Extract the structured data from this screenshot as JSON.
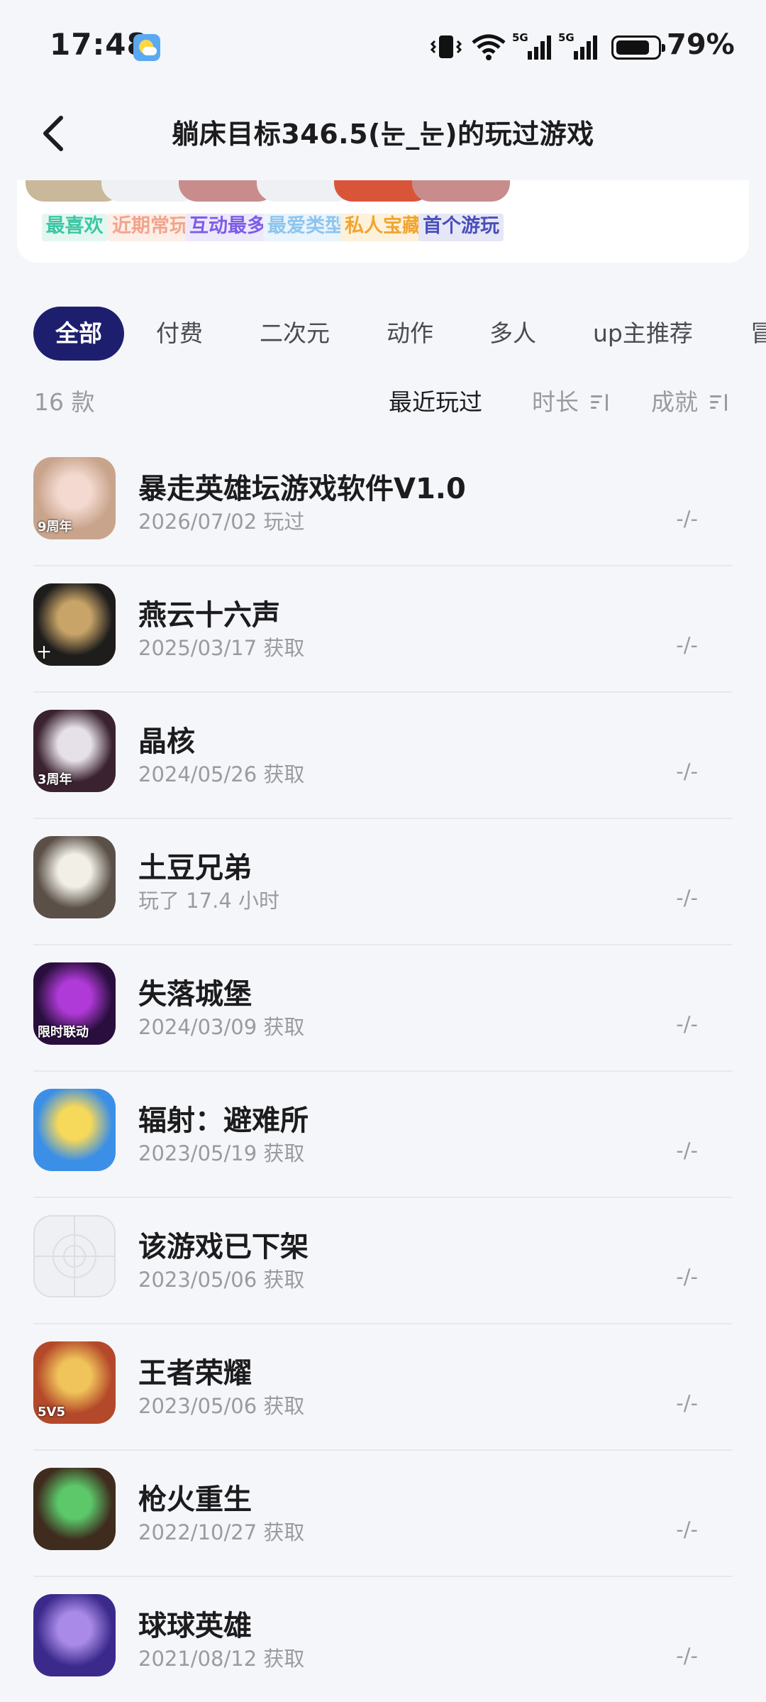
{
  "status_bar": {
    "time": "17:48",
    "battery": "79%",
    "network": "5G",
    "icons": [
      "weather-icon",
      "vibrate-icon",
      "wifi-icon",
      "signal-icon",
      "signal-icon",
      "battery-icon"
    ]
  },
  "nav": {
    "title": "躺床目标346.5(눈_눈)的玩过游戏",
    "back_icon": "chevron-left-icon"
  },
  "highlights": [
    {
      "label": "最喜欢",
      "color": "#3cc7a4",
      "bg": "#e3f7f0",
      "thumb": "#c9b89a"
    },
    {
      "label": "近期常玩",
      "color": "#f2a48c",
      "bg": "#fdeee8",
      "thumb": "#eef0f4"
    },
    {
      "label": "互动最多",
      "color": "#7d5ce8",
      "bg": "#eee8fc",
      "thumb": "#c98c8c"
    },
    {
      "label": "最爱类型",
      "color": "#8ec5ee",
      "bg": "#e9f4fc",
      "thumb": "#eef0f4"
    },
    {
      "label": "私人宝藏",
      "color": "#f1a52f",
      "bg": "#fdf1dc",
      "thumb": "#d9553a"
    },
    {
      "label": "首个游玩",
      "color": "#4a4fb8",
      "bg": "#e5e7f7",
      "thumb": "#c98c8c"
    }
  ],
  "filter_tabs": [
    {
      "label": "全部",
      "active": true
    },
    {
      "label": "付费",
      "active": false
    },
    {
      "label": "二次元",
      "active": false
    },
    {
      "label": "动作",
      "active": false
    },
    {
      "label": "多人",
      "active": false
    },
    {
      "label": "up主推荐",
      "active": false
    },
    {
      "label": "冒",
      "active": false
    }
  ],
  "sort": {
    "count": "16 款",
    "options": [
      {
        "label": "最近玩过",
        "active": true
      },
      {
        "label": "时长",
        "active": false
      },
      {
        "label": "成就",
        "active": false
      }
    ]
  },
  "games": [
    {
      "name": "暴走英雄坛游戏软件V1.0",
      "meta": "2026/07/02 玩过",
      "score": "-/-",
      "icon_color": "#c9a48c",
      "icon_accent": "#f3d9cf",
      "badge": "9周年"
    },
    {
      "name": "燕云十六声",
      "meta": "2025/03/17 获取",
      "score": "-/-",
      "icon_color": "#1e1d1c",
      "icon_accent": "#c8a468",
      "badge": "十"
    },
    {
      "name": "晶核",
      "meta": "2024/05/26 获取",
      "score": "-/-",
      "icon_color": "#3b2230",
      "icon_accent": "#e6e1e8",
      "badge": "3周年"
    },
    {
      "name": "土豆兄弟",
      "meta": "玩了 17.4 小时",
      "score": "-/-",
      "icon_color": "#5a5048",
      "icon_accent": "#f1efe6",
      "badge": ""
    },
    {
      "name": "失落城堡",
      "meta": "2024/03/09 获取",
      "score": "-/-",
      "icon_color": "#2a0f3e",
      "icon_accent": "#b03ad8",
      "badge": "限时联动"
    },
    {
      "name": "辐射：避难所",
      "meta": "2023/05/19 获取",
      "score": "-/-",
      "icon_color": "#3c8fe6",
      "icon_accent": "#f6d85a",
      "badge": ""
    },
    {
      "name": "该游戏已下架",
      "meta": "2023/05/06 获取",
      "score": "-/-",
      "icon_color": "#eef0f3",
      "icon_accent": "#dcdee3",
      "badge": ""
    },
    {
      "name": "王者荣耀",
      "meta": "2023/05/06 获取",
      "score": "-/-",
      "icon_color": "#b4482a",
      "icon_accent": "#f0c45a",
      "badge": "5V5"
    },
    {
      "name": "枪火重生",
      "meta": "2022/10/27 获取",
      "score": "-/-",
      "icon_color": "#3f2c1e",
      "icon_accent": "#5cc86a",
      "badge": ""
    },
    {
      "name": "球球英雄",
      "meta": "2021/08/12 获取",
      "score": "-/-",
      "icon_color": "#3b2a8c",
      "icon_accent": "#a98ae8",
      "badge": ""
    }
  ]
}
